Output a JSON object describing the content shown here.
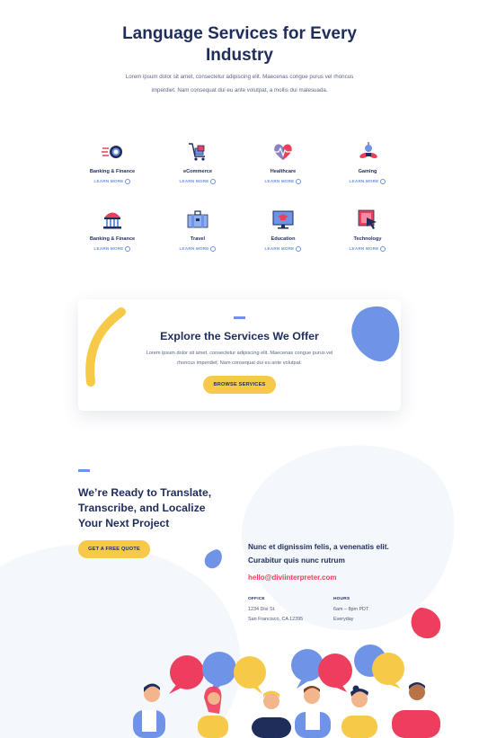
{
  "hero": {
    "title_line1": "Language Services for Every",
    "title_line2": "Industry",
    "subtitle": "Lorem ipsum dolor sit amet, consectetur adipiscing elit. Maecenas congue purus vel rhoncus imperdiet. Nam consequat dui eu ante volutpat, a mollis dui malesuada."
  },
  "industries": [
    {
      "label": "Banking & Finance",
      "link": "LEARN MORE",
      "icon": "coin-icon"
    },
    {
      "label": "eCommerce",
      "link": "LEARN MORE",
      "icon": "cart-icon"
    },
    {
      "label": "Healthcare",
      "link": "LEARN MORE",
      "icon": "heart-pulse-icon"
    },
    {
      "label": "Gaming",
      "link": "LEARN MORE",
      "icon": "gamepad-icon"
    },
    {
      "label": "Banking & Finance",
      "link": "LEARN MORE",
      "icon": "bank-icon"
    },
    {
      "label": "Travel",
      "link": "LEARN MORE",
      "icon": "suitcase-icon"
    },
    {
      "label": "Education",
      "link": "LEARN MORE",
      "icon": "graduation-monitor-icon"
    },
    {
      "label": "Technology",
      "link": "LEARN MORE",
      "icon": "cursor-icon"
    }
  ],
  "services": {
    "title": "Explore the Services We Offer",
    "subtitle": "Lorem ipsum dolor sit amet, consectetur adipiscing elit. Maecenas congue purus vel rhoncus imperdiet. Nam consequat dui eu ante volutpat.",
    "button": "BROWSE SERVICES"
  },
  "contact": {
    "heading_line1": "We’re Ready to Translate,",
    "heading_line2": "Transcribe, and Localize",
    "heading_line3": "Your Next Project",
    "button": "GET A FREE QUOTE",
    "info_line1": "Nunc et dignissim felis, a venenatis elit.",
    "info_line2": "Curabitur quis nunc rutrum",
    "email": "hello@diviinterpreter.com",
    "office_label": "OFFICE",
    "office_line1": "1234 Divi St.",
    "office_line2": "San Francisco, CA 12395",
    "hours_label": "HOURS",
    "hours_line1": "6am – 8pm PDT",
    "hours_line2": "Everyday"
  },
  "colors": {
    "navy": "#1f2d5a",
    "accent_blue": "#6f93e6",
    "yellow": "#f7c948",
    "red": "#ee3e5d"
  }
}
